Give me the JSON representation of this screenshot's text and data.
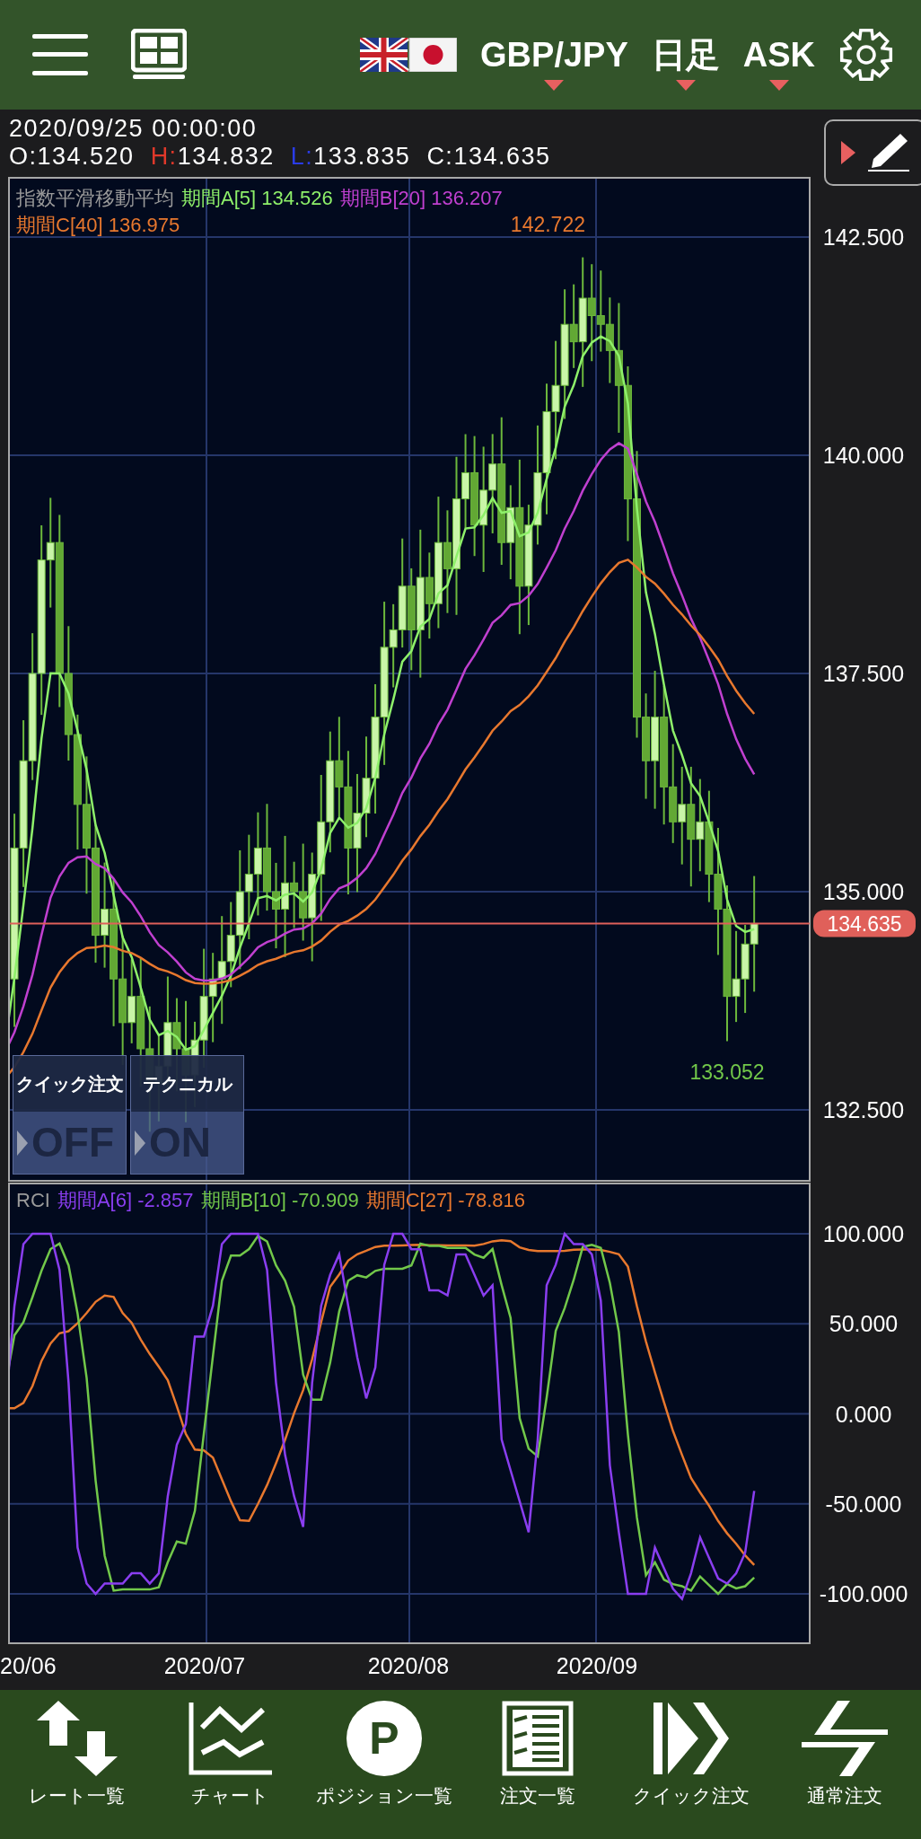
{
  "header": {
    "pair": "GBP/JPY",
    "timeframe": "日足",
    "price_side": "ASK"
  },
  "info": {
    "datetime": "2020/09/25 00:00:00",
    "ohlc": [
      {
        "label": "O:",
        "value": "134.520",
        "color": "#ffffff"
      },
      {
        "label": "H:",
        "value": "134.832",
        "color": "#e0382a"
      },
      {
        "label": "L:",
        "value": "133.835",
        "color": "#2a3ce8"
      },
      {
        "label": "C:",
        "value": "134.635",
        "color": "#ffffff"
      }
    ]
  },
  "price_chart": {
    "legend": [
      {
        "text": "指数平滑移動平均",
        "color": "#9a9a9a"
      },
      {
        "text": "期間A[5] 134.526",
        "color": "#8ef06a"
      },
      {
        "text": "期間B[20] 136.207",
        "color": "#c040d0"
      },
      {
        "text": "期間C[40] 136.975",
        "color": "#e8782e"
      }
    ],
    "y_axis_labels": [
      "142.500",
      "140.000",
      "137.500",
      "135.000",
      "132.500"
    ],
    "current_price": "134.635",
    "high_marker": "142.722",
    "low_marker": "133.052"
  },
  "overlay_toggles": [
    {
      "label": "クイック注文",
      "value": "OFF"
    },
    {
      "label": "テクニカル",
      "value": "ON"
    }
  ],
  "rci_chart": {
    "legend": [
      {
        "text": "RCI",
        "color": "#9a9a9a"
      },
      {
        "text": "期間A[6] -2.857",
        "color": "#8a3ef0"
      },
      {
        "text": "期間B[10] -70.909",
        "color": "#72c84a"
      },
      {
        "text": "期間C[27] -78.816",
        "color": "#e8782e"
      }
    ],
    "y_axis_labels": [
      "100.000",
      "50.000",
      "0.000",
      "-50.000",
      "-100.000"
    ]
  },
  "x_axis_labels": [
    "20/06",
    "2020/07",
    "2020/08",
    "2020/09"
  ],
  "bottom_nav": [
    {
      "kind": "rates",
      "label": "レート一覧"
    },
    {
      "kind": "chart",
      "label": "チャート"
    },
    {
      "kind": "positions",
      "label": "ポジション一覧",
      "icon_text": "P"
    },
    {
      "kind": "orders",
      "label": "注文一覧"
    },
    {
      "kind": "quick",
      "label": "クイック注文"
    },
    {
      "kind": "normal",
      "label": "通常注文"
    }
  ]
}
